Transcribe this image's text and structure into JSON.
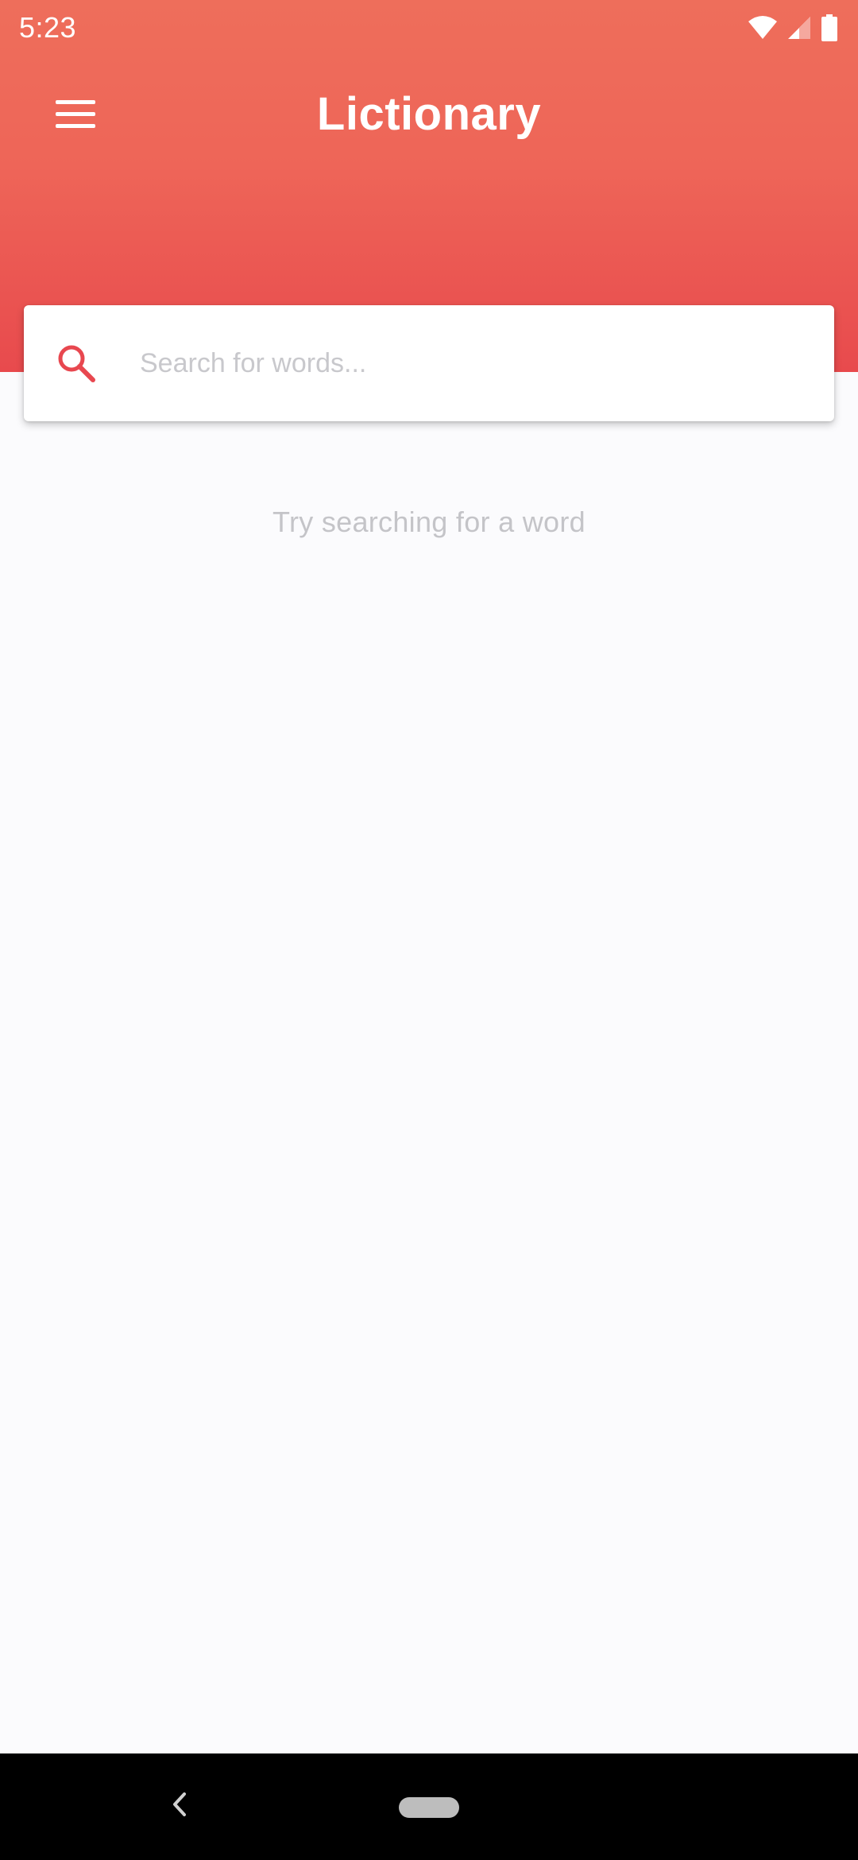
{
  "status_bar": {
    "time": "5:23",
    "icons": [
      "wifi-icon",
      "cellular-signal-icon",
      "battery-icon"
    ]
  },
  "app_bar": {
    "title": "Lictionary",
    "menu_icon": "hamburger-menu-icon"
  },
  "search": {
    "placeholder": "Search for words...",
    "value": "",
    "icon": "search-icon"
  },
  "main": {
    "empty_hint": "Try searching for a word"
  },
  "nav_bar": {
    "icons": [
      "back-icon",
      "home-pill"
    ]
  },
  "colors": {
    "header_top": "#ee6e5b",
    "header_bottom": "#e84a4d",
    "accent": "#e8474f",
    "background": "#fbfbfd",
    "hint_text": "#c4c4c8"
  }
}
